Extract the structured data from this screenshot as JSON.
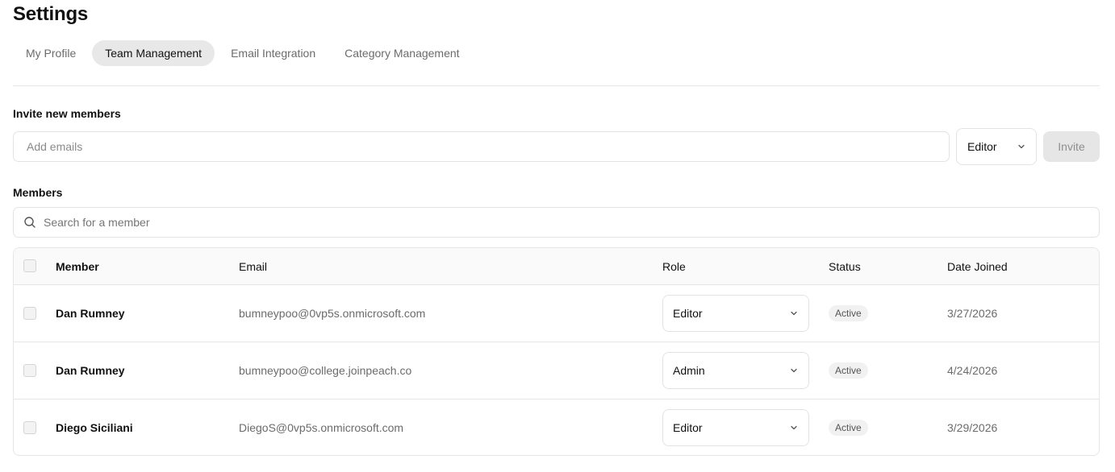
{
  "page": {
    "title": "Settings"
  },
  "tabs": [
    {
      "label": "My Profile",
      "active": false
    },
    {
      "label": "Team Management",
      "active": true
    },
    {
      "label": "Email Integration",
      "active": false
    },
    {
      "label": "Category Management",
      "active": false
    }
  ],
  "invite": {
    "section_label": "Invite new members",
    "email_placeholder": "Add emails",
    "email_value": "",
    "role_value": "Editor",
    "button_label": "Invite"
  },
  "members": {
    "section_label": "Members",
    "search_placeholder": "Search for a member",
    "search_value": "",
    "columns": [
      "Member",
      "Email",
      "Role",
      "Status",
      "Date Joined"
    ],
    "rows": [
      {
        "name": "Dan Rumney",
        "email": "bumneypoo@0vp5s.onmicrosoft.com",
        "role": "Editor",
        "status": "Active",
        "date_joined": "3/27/2026"
      },
      {
        "name": "Dan Rumney",
        "email": "bumneypoo@college.joinpeach.co",
        "role": "Admin",
        "status": "Active",
        "date_joined": "4/24/2026"
      },
      {
        "name": "Diego Siciliani",
        "email": "DiegoS@0vp5s.onmicrosoft.com",
        "role": "Editor",
        "status": "Active",
        "date_joined": "3/29/2026"
      }
    ]
  },
  "icons": {
    "search": "search-icon",
    "dropdown": "chevron-down-icon"
  },
  "colors": {
    "active_tab_bg": "#e8e8e8",
    "border": "#e6e6e6",
    "muted_text": "#6b6b6b",
    "button_disabled_bg": "#e6e6e6"
  }
}
